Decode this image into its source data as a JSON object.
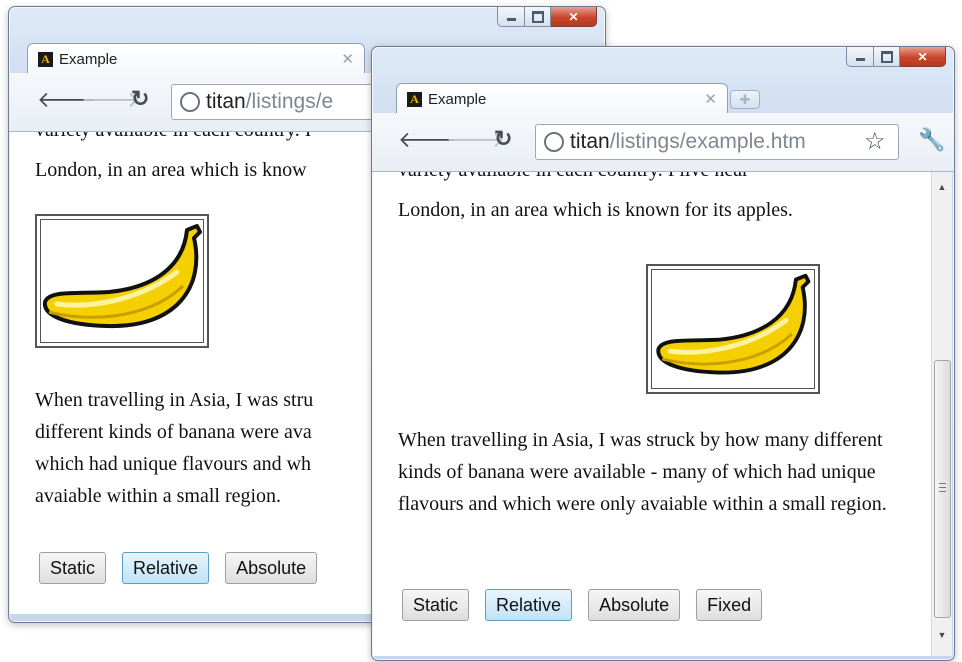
{
  "back_window": {
    "tab_title": "Example",
    "url_host": "titan",
    "url_path": "/listings/e",
    "clipped_top": "variety available in each country. I",
    "line2": "London, in an area which is know",
    "para_lines": [
      "When travelling in Asia, I was stru",
      "different kinds of banana were ava",
      "which had unique flavours and wh",
      "avaiable within a small region."
    ],
    "buttons": [
      "Static",
      "Relative",
      "Absolute"
    ],
    "active_button": "Relative"
  },
  "front_window": {
    "tab_title": "Example",
    "url_host": "titan",
    "url_path": "/listings/example.htm",
    "clipped_top": "variety available in each country. I live near",
    "line2": "London, in an area which is known for its apples.",
    "paragraph": "When travelling in Asia, I was struck by how many different kinds of banana were available - many of which had unique flavours and which were only avaiable within a small region.",
    "buttons": [
      "Static",
      "Relative",
      "Absolute",
      "Fixed"
    ],
    "active_button": "Relative"
  },
  "icons": {
    "back": "back-arrow-icon",
    "forward": "forward-arrow-icon",
    "reload": "reload-icon",
    "page": "globe-icon",
    "bookmark": "star-icon",
    "settings": "wrench-icon",
    "favicon": "favicon-icon"
  },
  "colors": {
    "accent_button": "#c1e3f7",
    "close_button": "#c9462c",
    "frame": "#c9d9ee",
    "banana": "#f5d000"
  }
}
